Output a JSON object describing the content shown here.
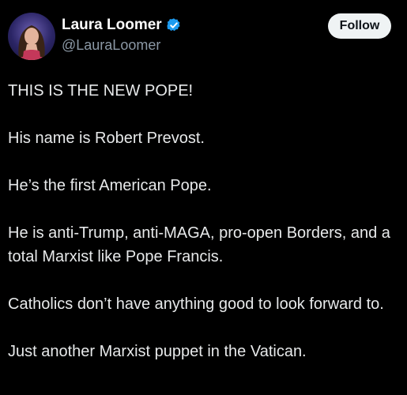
{
  "author": {
    "display_name": "Laura Loomer",
    "handle": "@LauraLoomer",
    "verified": true,
    "avatar_icon": "profile-photo"
  },
  "actions": {
    "follow_label": "Follow"
  },
  "post": {
    "paragraphs": [
      "THIS IS THE NEW POPE!",
      "His name is Robert Prevost.",
      "He’s the first American Pope.",
      "He is anti-Trump, anti-MAGA, pro-open Borders, and a total Marxist like Pope Francis.",
      "Catholics don’t have anything good to look forward to.",
      "Just another Marxist puppet in the Vatican."
    ]
  },
  "colors": {
    "background": "#000000",
    "text_primary": "#e7e9ea",
    "text_secondary": "#8b98a5",
    "verified_badge": "#1d9bf0",
    "follow_button_bg": "#eff3f4",
    "follow_button_text": "#0f1419"
  }
}
